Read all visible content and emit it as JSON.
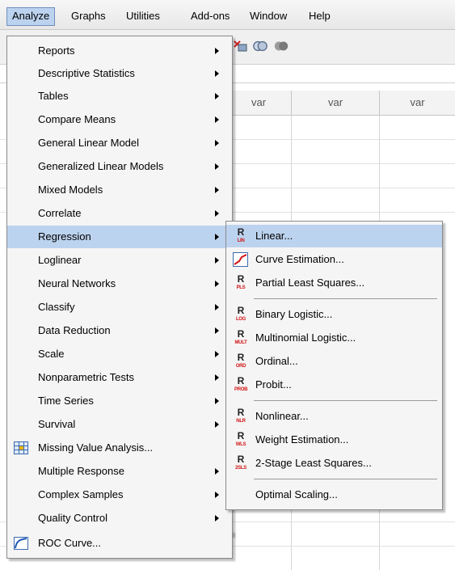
{
  "menubar": {
    "items": [
      {
        "label": "Analyze"
      },
      {
        "label": "Graphs"
      },
      {
        "label": "Utilities"
      },
      {
        "label": "Add-ons"
      },
      {
        "label": "Window"
      },
      {
        "label": "Help"
      }
    ]
  },
  "grid": {
    "columns": [
      {
        "label": "var"
      },
      {
        "label": "var"
      },
      {
        "label": "var"
      }
    ]
  },
  "analyze_menu": {
    "items": [
      {
        "label": "Reports"
      },
      {
        "label": "Descriptive Statistics"
      },
      {
        "label": "Tables"
      },
      {
        "label": "Compare Means"
      },
      {
        "label": "General Linear Model"
      },
      {
        "label": "Generalized Linear Models"
      },
      {
        "label": "Mixed Models"
      },
      {
        "label": "Correlate"
      },
      {
        "label": "Regression"
      },
      {
        "label": "Loglinear"
      },
      {
        "label": "Neural Networks"
      },
      {
        "label": "Classify"
      },
      {
        "label": "Data Reduction"
      },
      {
        "label": "Scale"
      },
      {
        "label": "Nonparametric Tests"
      },
      {
        "label": "Time Series"
      },
      {
        "label": "Survival"
      },
      {
        "label": "Missing Value Analysis..."
      },
      {
        "label": "Multiple Response"
      },
      {
        "label": "Complex Samples"
      },
      {
        "label": "Quality Control"
      },
      {
        "label": "ROC Curve..."
      }
    ]
  },
  "regression_menu": {
    "items": [
      {
        "label": "Linear...",
        "icon_text": "LIN"
      },
      {
        "label": "Curve Estimation...",
        "icon_text": ""
      },
      {
        "label": "Partial Least Squares...",
        "icon_text": "PLS"
      },
      {
        "label": "Binary Logistic...",
        "icon_text": "LOG"
      },
      {
        "label": "Multinomial Logistic...",
        "icon_text": "MULT"
      },
      {
        "label": "Ordinal...",
        "icon_text": "ORD"
      },
      {
        "label": "Probit...",
        "icon_text": "PROB"
      },
      {
        "label": "Nonlinear...",
        "icon_text": "NLR"
      },
      {
        "label": "Weight Estimation...",
        "icon_text": "WLS"
      },
      {
        "label": "2-Stage Least Squares...",
        "icon_text": "2SLS"
      },
      {
        "label": "Optimal Scaling...",
        "icon_text": ""
      }
    ],
    "icon_letter": "R"
  },
  "colors": {
    "highlight": "#bcd3ef",
    "menu_bg": "#f5f5f5",
    "icon_red": "#d21414"
  }
}
